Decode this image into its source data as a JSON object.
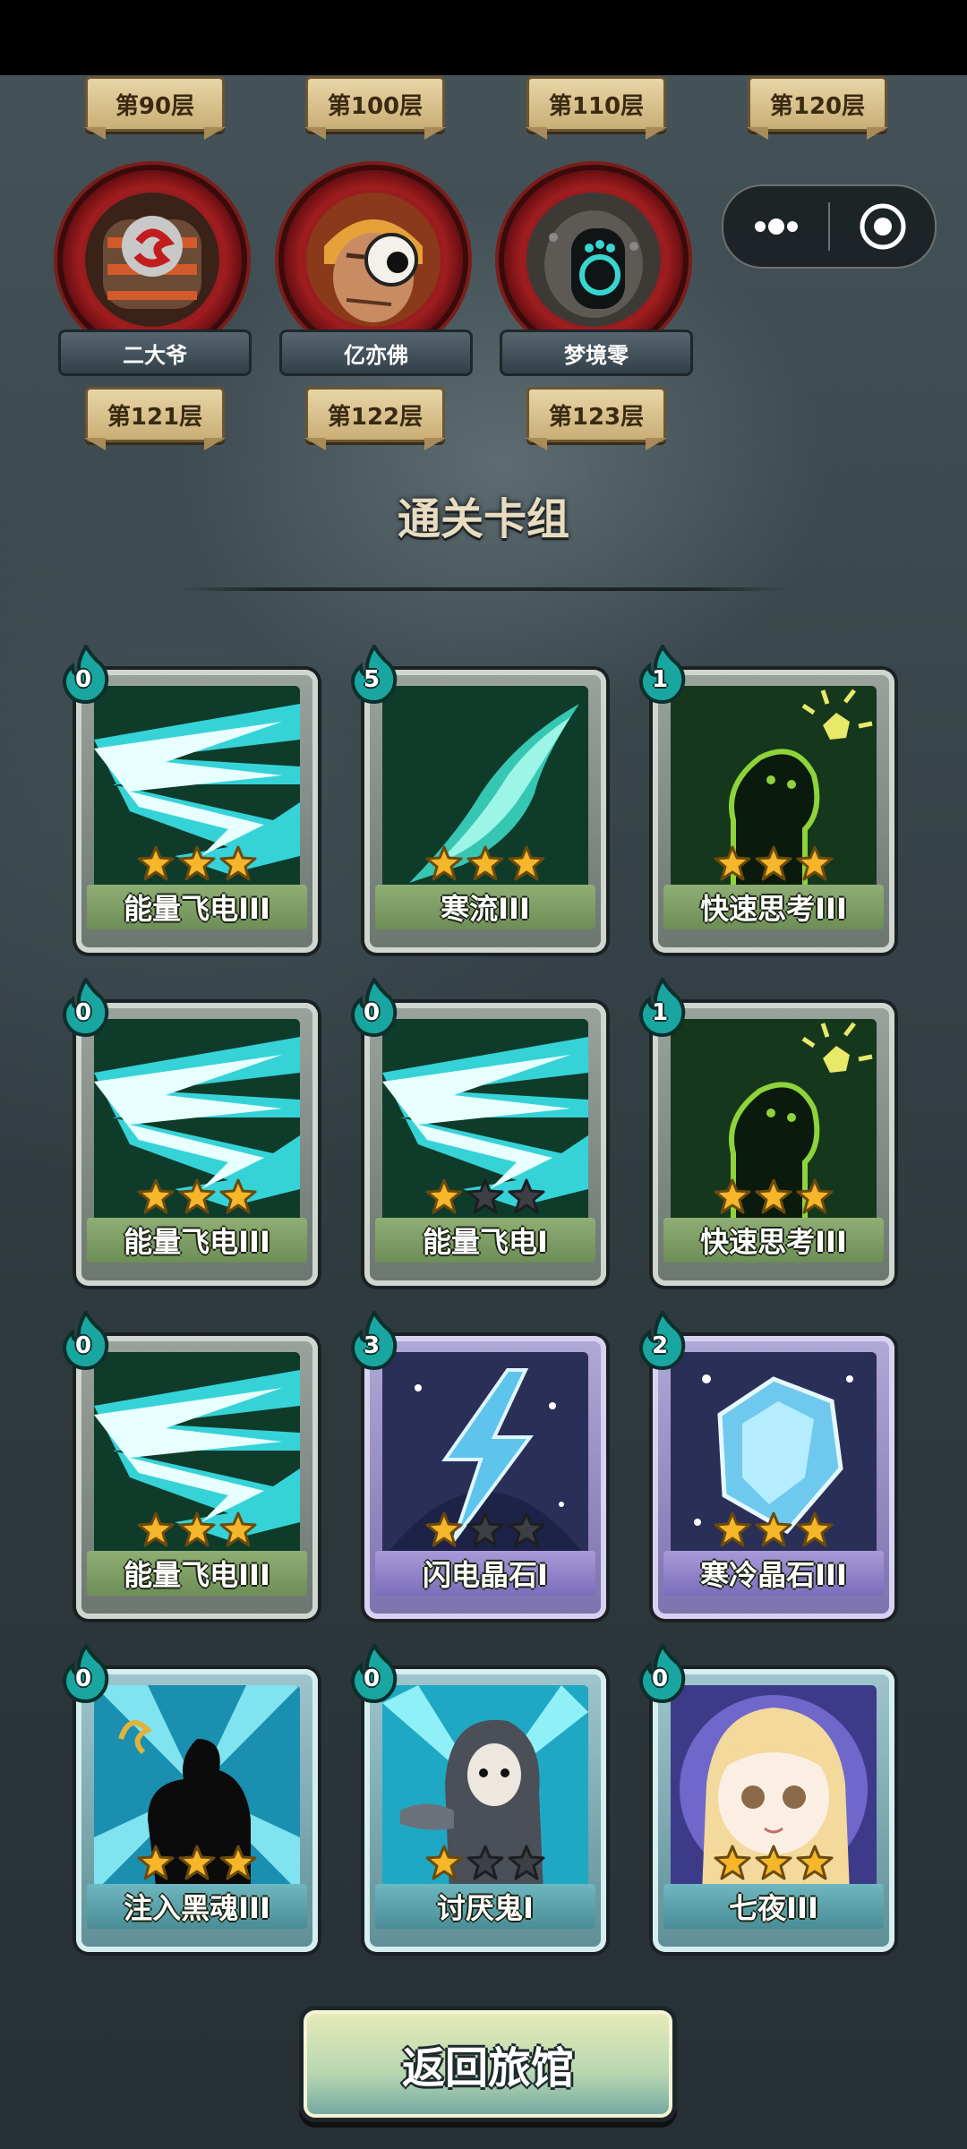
{
  "floor_labels_top": [
    "第90层",
    "第100层",
    "第110层",
    "第120层"
  ],
  "bosses": [
    {
      "name": "二大爷",
      "floor": "第121层",
      "icon": "armored-beast-portrait"
    },
    {
      "name": "亿亦佛",
      "floor": "第122层",
      "icon": "one-eyed-monk-portrait"
    },
    {
      "name": "梦境零",
      "floor": "第123层",
      "icon": "dream-robot-portrait"
    }
  ],
  "capsule": {
    "menu_icon": "more-dots-icon",
    "close_icon": "target-circle-icon"
  },
  "section_title": "通关卡组",
  "cards": [
    {
      "name": "能量飞电III",
      "cost": "0",
      "stars": 3,
      "type": "lightning"
    },
    {
      "name": "寒流III",
      "cost": "5",
      "stars": 3,
      "type": "coldwave"
    },
    {
      "name": "快速思考III",
      "cost": "1",
      "stars": 3,
      "type": "think"
    },
    {
      "name": "能量飞电III",
      "cost": "0",
      "stars": 3,
      "type": "lightning"
    },
    {
      "name": "能量飞电I",
      "cost": "0",
      "stars": 1,
      "type": "lightning"
    },
    {
      "name": "快速思考III",
      "cost": "1",
      "stars": 3,
      "type": "think"
    },
    {
      "name": "能量飞电III",
      "cost": "0",
      "stars": 3,
      "type": "lightning"
    },
    {
      "name": "闪电晶石I",
      "cost": "3",
      "stars": 1,
      "type": "crystal-bolt"
    },
    {
      "name": "寒冷晶石III",
      "cost": "2",
      "stars": 3,
      "type": "ice-gem"
    },
    {
      "name": "注入黑魂III",
      "cost": "0",
      "stars": 3,
      "type": "dark-soul"
    },
    {
      "name": "讨厌鬼I",
      "cost": "0",
      "stars": 1,
      "type": "hooded"
    },
    {
      "name": "七夜III",
      "cost": "0",
      "stars": 3,
      "type": "girl"
    }
  ],
  "back_button": "返回旅馆",
  "colors": {
    "star_on": "#f5b62a",
    "star_off": "#3c3f44",
    "cost_flame": "#1aa6a0"
  }
}
